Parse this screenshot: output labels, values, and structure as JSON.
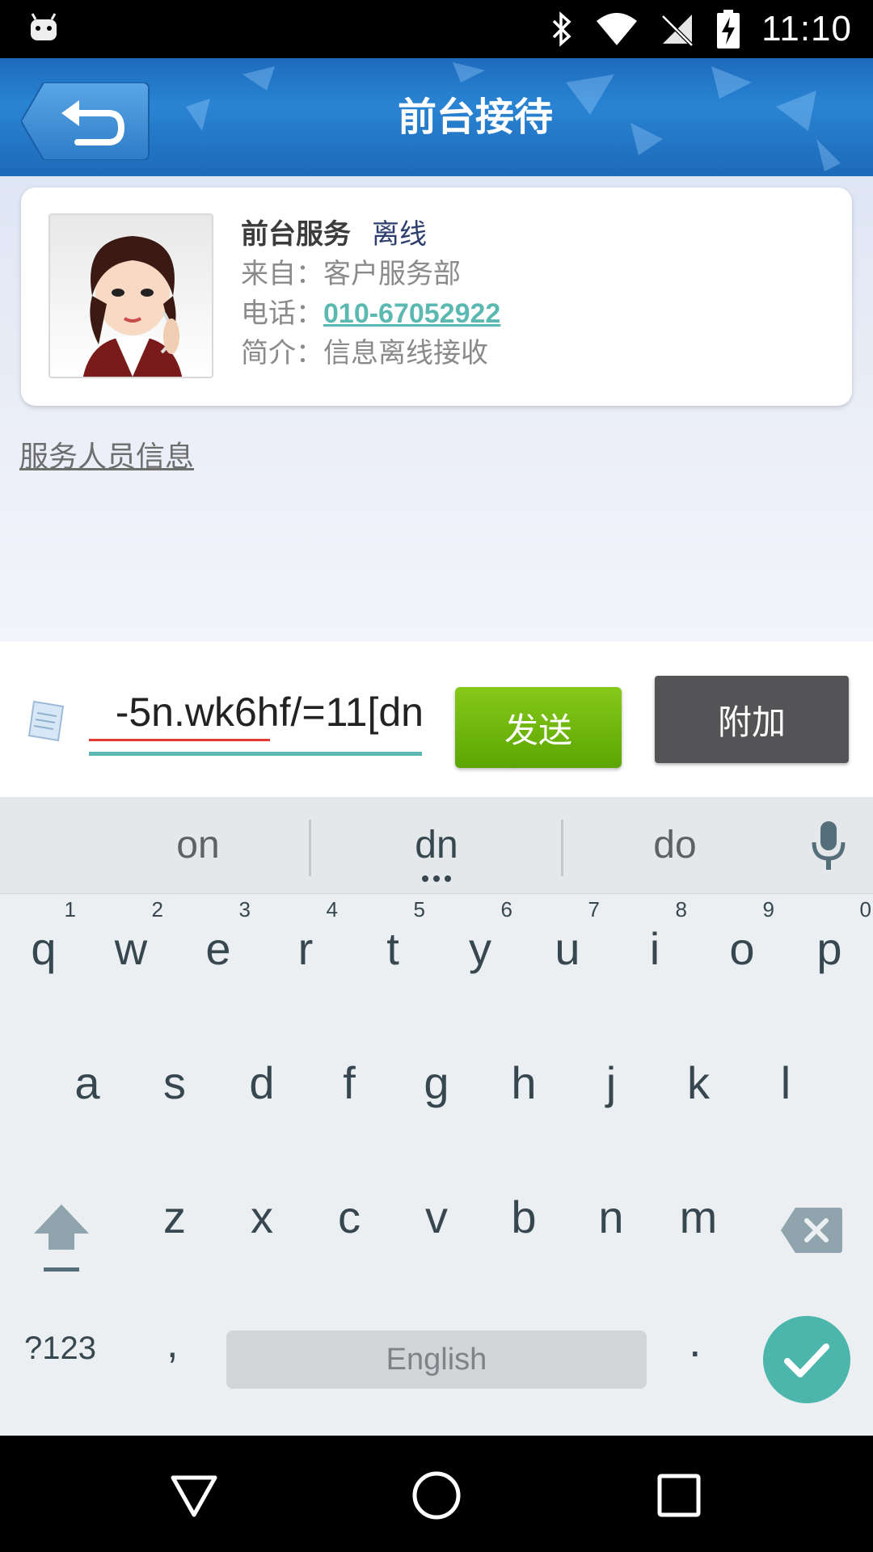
{
  "status_bar": {
    "time": "11:10",
    "icons": [
      "android-icon",
      "bluetooth-icon",
      "wifi-icon",
      "no-sim-icon",
      "battery-charging-icon"
    ]
  },
  "header": {
    "title": "前台接待",
    "back_icon": "back-arrow-icon",
    "colors": {
      "bar": "#2a84d3",
      "back_button": "#3e8fd8"
    }
  },
  "contact_card": {
    "name": "前台服务",
    "status": "离线",
    "from_label": "来自：",
    "from_value": "客户服务部",
    "phone_label": "电话：",
    "phone_value": "010-67052922",
    "intro_label": "简介：",
    "intro_value": "信息离线接收",
    "avatar": "receptionist-avatar"
  },
  "service_info_link": "服务人员信息",
  "input_bar": {
    "text_value": "-5n.wk6hf/=11[dn",
    "send_label": "发送",
    "attach_label": "附加",
    "colors": {
      "send": "#6fb70c",
      "attach": "#545456",
      "underline": "#5cb8b2"
    }
  },
  "keyboard": {
    "suggestions": [
      "on",
      "dn",
      "do"
    ],
    "row1": [
      {
        "ch": "q",
        "num": "1"
      },
      {
        "ch": "w",
        "num": "2"
      },
      {
        "ch": "e",
        "num": "3"
      },
      {
        "ch": "r",
        "num": "4"
      },
      {
        "ch": "t",
        "num": "5"
      },
      {
        "ch": "y",
        "num": "6"
      },
      {
        "ch": "u",
        "num": "7"
      },
      {
        "ch": "i",
        "num": "8"
      },
      {
        "ch": "o",
        "num": "9"
      },
      {
        "ch": "p",
        "num": "0"
      }
    ],
    "row2": [
      "a",
      "s",
      "d",
      "f",
      "g",
      "h",
      "j",
      "k",
      "l"
    ],
    "row3": [
      "z",
      "x",
      "c",
      "v",
      "b",
      "n",
      "m"
    ],
    "symbols_label": "?123",
    "comma_label": ",",
    "space_label": "English",
    "period_label": ".",
    "enter_color": "#4db6ac"
  },
  "nav_bar": {
    "icons": [
      "back-triangle-icon",
      "home-circle-icon",
      "recents-square-icon"
    ]
  }
}
